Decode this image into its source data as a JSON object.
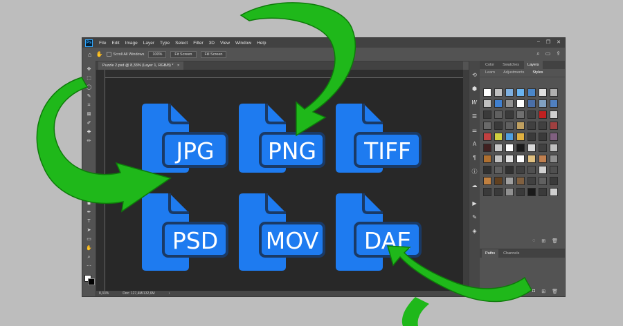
{
  "app": {
    "logo": "Ps",
    "menu": [
      "File",
      "Edit",
      "Image",
      "Layer",
      "Type",
      "Select",
      "Filter",
      "3D",
      "View",
      "Window",
      "Help"
    ],
    "window_controls": [
      "–",
      "❐",
      "✕"
    ]
  },
  "options_bar": {
    "scroll_all_windows": "Scroll All Windows",
    "zoom_percent": "100%",
    "fit_screen": "Fit Screen",
    "fill_screen": "Fill Screen"
  },
  "document": {
    "tab_title": "Puzzle 2.psd @ 8,33% (Layer 1, RGB/8) *",
    "close": "×"
  },
  "status_bar": {
    "zoom": "8,33%",
    "doc_size": "Doc: 127,4M/132,6M",
    "arrow": "›"
  },
  "panels": {
    "top_tabs": [
      "Color",
      "Swatches",
      "Layers"
    ],
    "sub_tabs": [
      "Learn",
      "Adjustments",
      "Styles"
    ],
    "bottom_tabs": [
      "Paths",
      "Channels"
    ]
  },
  "files": [
    "JPG",
    "PNG",
    "TIFF",
    "PSD",
    "MOV",
    "DAE"
  ],
  "colors": {
    "file_icon": "#1E7BF0",
    "file_icon_outline": "#1a3a66",
    "arrow_green": "#1fb81a",
    "canvas": "#282828",
    "page_background": "#bdbdbd"
  },
  "style_swatches": [
    "#ffffff",
    "#c0c0c0",
    "#7fb0e0",
    "#6ab4f0",
    "#4a86c8",
    "#e0e0e0",
    "#b0b0b0",
    "#c0c0c0",
    "#4080d0",
    "#909090",
    "#ffffff",
    "#4a6fa8",
    "#80a0c0",
    "#5080c0",
    "#3a3a3a",
    "#606060",
    "#3a3a3a",
    "#707070",
    "#404040",
    "#c02020",
    "#d0d0d0",
    "#6a6a6a",
    "#3a3a3a",
    "#606060",
    "#c0a060",
    "#404040",
    "#404040",
    "#a04040",
    "#c04040",
    "#d0d040",
    "#50a0e0",
    "#e0b040",
    "#3a3a3a",
    "#3a3a3a",
    "#806080",
    "#402020",
    "#c8c8c8",
    "#ffffff",
    "#1a1a1a",
    "#d8d8d8",
    "#404040",
    "#c0c0c0",
    "#b07030",
    "#c0c0c0",
    "#e0e0e0",
    "#ffffff",
    "#e0c080",
    "#c08050",
    "#909090",
    "#303030",
    "#606060",
    "#303030",
    "#404040",
    "#505050",
    "#d0d0d0",
    "#505050",
    "#c08040",
    "#604020",
    "#a0a0a0",
    "#806040",
    "#404040",
    "#606060",
    "#3a3a3a",
    "#3a3a3a",
    "#3a3a3a",
    "#909090",
    "#3a3a3a",
    "#1a1a1a",
    "#3a3a3a",
    "#d0d0d0"
  ]
}
